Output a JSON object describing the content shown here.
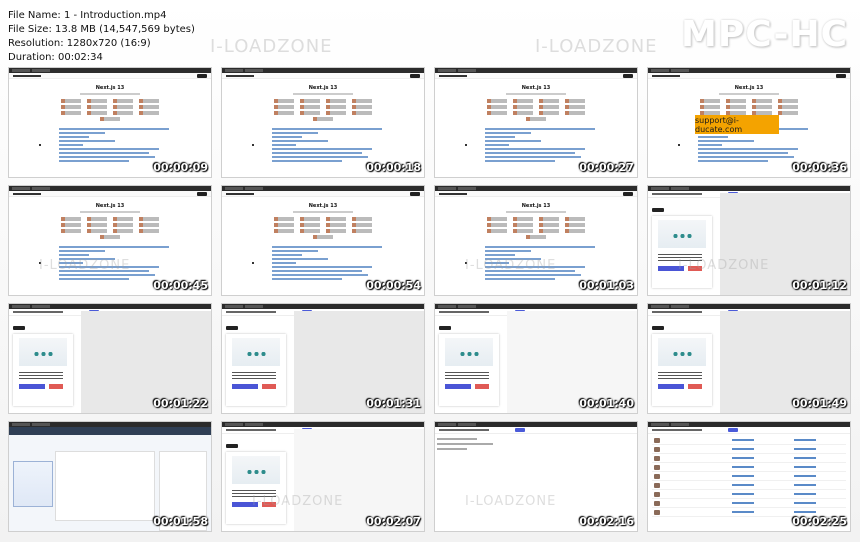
{
  "file_info": {
    "file_name": "File Name: 1 - Introduction.mp4",
    "file_size": "File Size: 13.8 MB (14,547,569 bytes)",
    "resolution": "Resolution: 1280x720 (16:9)",
    "duration": "Duration: 00:02:34"
  },
  "brand": "MPC-HC",
  "watermark": "I-LOADZONE",
  "support_email": "support@i-ducate.com",
  "nextjs_title": "Next.js 13",
  "thumbnails": [
    {
      "time": "00:00:09",
      "scene": "nextjs"
    },
    {
      "time": "00:00:18",
      "scene": "nextjs"
    },
    {
      "time": "00:00:27",
      "scene": "nextjs"
    },
    {
      "time": "00:00:36",
      "scene": "nextjs-support"
    },
    {
      "time": "00:00:45",
      "scene": "nextjs"
    },
    {
      "time": "00:00:54",
      "scene": "nextjs"
    },
    {
      "time": "00:01:03",
      "scene": "nextjs"
    },
    {
      "time": "00:01:12",
      "scene": "app"
    },
    {
      "time": "00:01:22",
      "scene": "app"
    },
    {
      "time": "00:01:31",
      "scene": "app"
    },
    {
      "time": "00:01:40",
      "scene": "app-light"
    },
    {
      "time": "00:01:49",
      "scene": "app"
    },
    {
      "time": "00:01:58",
      "scene": "blog"
    },
    {
      "time": "00:02:07",
      "scene": "app-light"
    },
    {
      "time": "00:02:16",
      "scene": "plain"
    },
    {
      "time": "00:02:25",
      "scene": "table"
    }
  ]
}
